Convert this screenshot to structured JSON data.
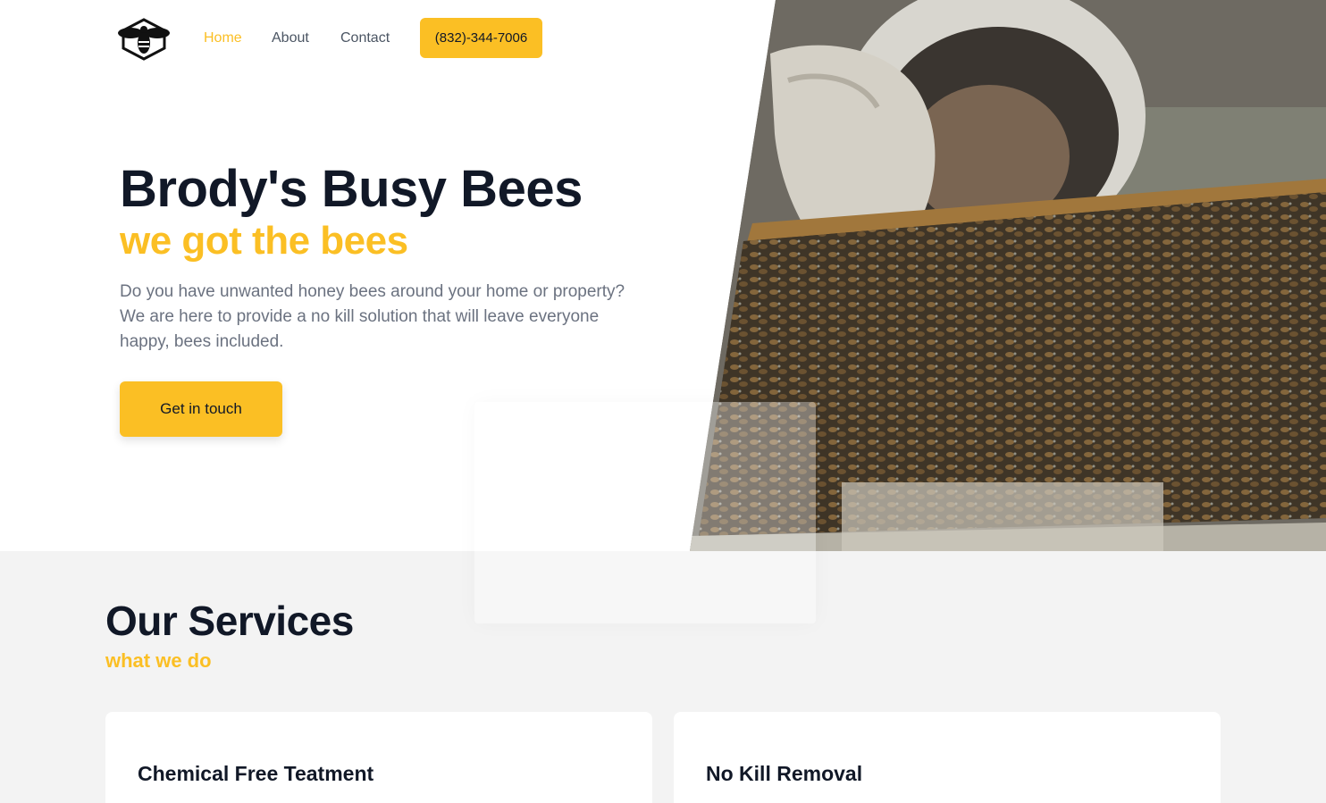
{
  "nav": {
    "logo_icon": "bee-logo-icon",
    "links": [
      {
        "label": "Home",
        "active": true
      },
      {
        "label": "About",
        "active": false
      },
      {
        "label": "Contact",
        "active": false
      }
    ],
    "phone": "(832)-344-7006"
  },
  "hero": {
    "title": "Brody's Busy Bees",
    "subtitle": "we got the bees",
    "description": "Do you have unwanted honey bees around your home or property? We are here to provide a no kill solution that will leave everyone happy, bees included.",
    "cta_label": "Get in touch",
    "image": "beekeeper-holding-honeycomb-frame"
  },
  "services": {
    "title": "Our Services",
    "subtitle": "what we do",
    "cards": [
      {
        "title": "Chemical Free Teatment"
      },
      {
        "title": "No Kill Removal"
      }
    ]
  },
  "colors": {
    "accent": "#fbbf24",
    "heading": "#111827",
    "body_text": "#6b7280",
    "section_bg": "#f3f3f3"
  }
}
